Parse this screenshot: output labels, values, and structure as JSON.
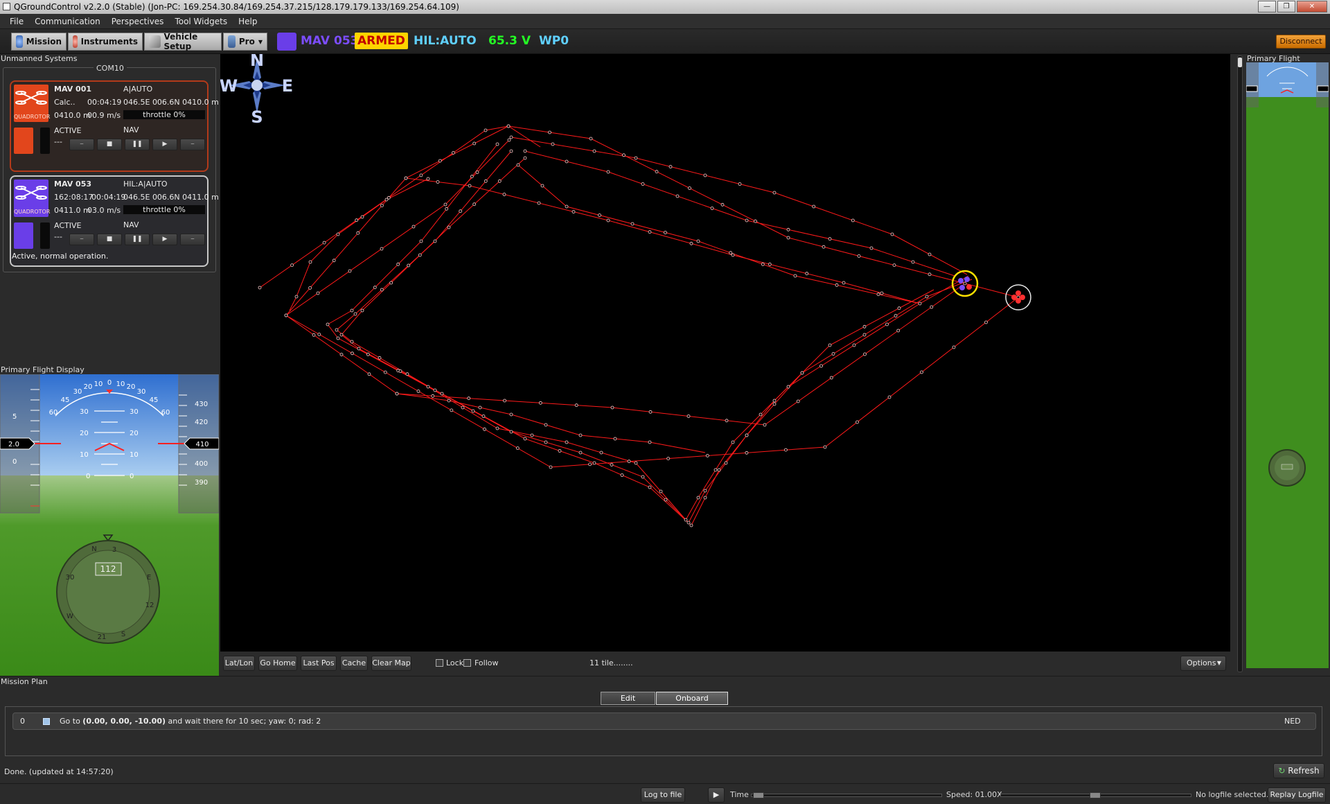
{
  "window": {
    "title": "QGroundControl v2.2.0 (Stable) (Jon-PC: 169.254.30.84/169.254.37.215/128.179.179.133/169.254.64.109)"
  },
  "menus": [
    "File",
    "Communication",
    "Perspectives",
    "Tool Widgets",
    "Help"
  ],
  "perspectives": {
    "mission": "Mission",
    "instruments": "Instruments",
    "vehicle_setup": "Vehicle Setup",
    "pro": "Pro"
  },
  "toolbar": {
    "mav": "MAV 053",
    "armed": "ARMED",
    "mode": "HIL:AUTO",
    "voltage": "65.3 V",
    "waypoint": "WP0",
    "disconnect": "Disconnect",
    "colors": {
      "mav": "#7c4dff",
      "armed_bg": "#ffd400",
      "armed_fg": "#c00000",
      "mode": "#5fd0ff",
      "voltage": "#24ff24",
      "disconnect": "#e38a1a"
    }
  },
  "left": {
    "dock_title": "Unmanned Systems",
    "link": "COM10",
    "uavs": [
      {
        "name": "MAV 001",
        "mode": "A|AUTO",
        "col1": "Calc..",
        "time": "00:04:19",
        "pos": "046.5E 006.6N 0410.0 m",
        "alt": "0410.0 m",
        "speed": "00.9 m/s",
        "throttle": "throttle 0%",
        "state": "ACTIVE",
        "nav": "NAV",
        "extra": "---",
        "type": "QUADROTOR",
        "color": "#e2461c"
      },
      {
        "name": "MAV 053",
        "mode": "HIL:A|AUTO",
        "col1": "162:08:17",
        "time": "00:04:19",
        "pos": "046.5E 006.6N 0411.0 m",
        "alt": "0411.0 m",
        "speed": "03.0 m/s",
        "throttle": "throttle 0%",
        "state": "ACTIVE",
        "nav": "NAV",
        "extra": "---",
        "type": "QUADROTOR",
        "color": "#6a3ee8"
      }
    ],
    "status": "Active, normal operation.",
    "pfd_title": "Primary Flight Display"
  },
  "pfd": {
    "speed": "2.0",
    "altitude": "410",
    "heading": "112",
    "speed_ticks": [
      "5",
      "0"
    ],
    "alt_ticks": [
      "430",
      "420",
      "400",
      "390"
    ],
    "pitch_left": [
      "30",
      "20",
      "10",
      "0"
    ],
    "pitch_right": [
      "30",
      "20",
      "10",
      "0"
    ],
    "roll_labels": [
      "60",
      "45",
      "30",
      "20",
      "10",
      "0",
      "10",
      "20",
      "30",
      "45",
      "60"
    ],
    "compass_labels": [
      "N",
      "3",
      "E",
      "12",
      "S",
      "21",
      "W",
      "30"
    ]
  },
  "map": {
    "compass": {
      "n": "N",
      "s": "S",
      "e": "E",
      "w": "W"
    },
    "buttons": {
      "latlon": "Lat/Lon",
      "gohome": "Go Home",
      "lastpos": "Last Pos",
      "cache": "Cache",
      "clearmap": "Clear Map",
      "options": "Options"
    },
    "lock": "Lock",
    "follow": "Follow",
    "tiles": "11 tile........",
    "track_color": "#ff1a1a"
  },
  "right": {
    "title": "Primary Flight Display"
  },
  "mission": {
    "title": "Mission Plan",
    "tabs": [
      "Edit Waypoints",
      "Onboard Waypoints"
    ],
    "waypoint": {
      "index": "0",
      "prefix": "Go to ",
      "coords": "(0.00, 0.00, -10.00)",
      "suffix": " and wait there for 10 sec; yaw: 0; rad: 2",
      "frame": "NED"
    },
    "status": "Done. (updated at 14:57:20)",
    "refresh": "Refresh"
  },
  "statusbar": {
    "log": "Log to file",
    "time": "Time",
    "speed": "Speed: 01.00X",
    "nolog": "No logfile selected..",
    "replay": "Replay Logfile"
  }
}
